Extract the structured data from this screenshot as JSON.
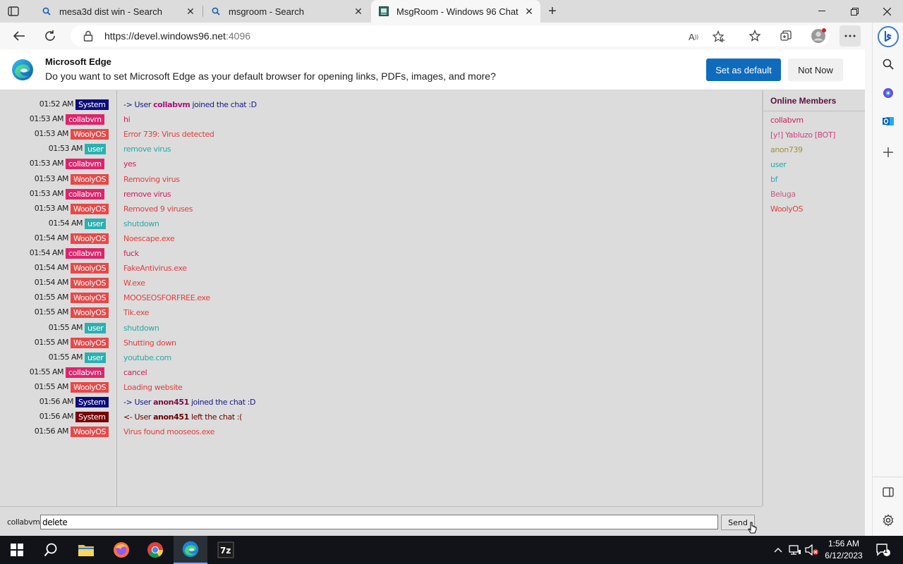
{
  "browser": {
    "tabs": [
      {
        "title": "mesa3d dist win - Search",
        "active": false
      },
      {
        "title": "msgroom - Search",
        "active": false
      },
      {
        "title": "MsgRoom - Windows 96 Chat",
        "active": true
      }
    ],
    "url_main": "https://devel.windows96.net",
    "url_port": ":4096"
  },
  "infobar": {
    "title": "Microsoft Edge",
    "text": "Do you want to set Microsoft Edge as your default browser for opening links, PDFs, images, and more?",
    "primary_label": "Set as default",
    "secondary_label": "Not Now"
  },
  "chat": {
    "messages": [
      {
        "time": "01:52 AM",
        "user": "System",
        "badge_color": "#0b0b7a",
        "pre": "-> User ",
        "bold": "collabvm",
        "post": " joined the chat :D",
        "text_color": "#1a1a8a",
        "bold_color": "#b0107a"
      },
      {
        "time": "01:53 AM",
        "user": "collabvm",
        "badge_color": "#e0236b",
        "text": "hi",
        "text_color": "#d0205a"
      },
      {
        "time": "01:53 AM",
        "user": "WoolyOS",
        "badge_color": "#e84848",
        "text": "Error 739: Virus detected",
        "text_color": "#e04040"
      },
      {
        "time": "01:53 AM",
        "user": "user",
        "badge_color": "#2bb0b0",
        "text": "remove virus",
        "text_color": "#2aa8a8"
      },
      {
        "time": "01:53 AM",
        "user": "collabvm",
        "badge_color": "#e0236b",
        "text": "yes",
        "text_color": "#d0205a"
      },
      {
        "time": "01:53 AM",
        "user": "WoolyOS",
        "badge_color": "#e84848",
        "text": "Removing virus",
        "text_color": "#e04040"
      },
      {
        "time": "01:53 AM",
        "user": "collabvm",
        "badge_color": "#e0236b",
        "text": "remove virus",
        "text_color": "#d0205a"
      },
      {
        "time": "01:53 AM",
        "user": "WoolyOS",
        "badge_color": "#e84848",
        "text": "Removed 9 viruses",
        "text_color": "#e04040"
      },
      {
        "time": "01:54 AM",
        "user": "user",
        "badge_color": "#2bb0b0",
        "text": "shutdown",
        "text_color": "#2aa8a8"
      },
      {
        "time": "01:54 AM",
        "user": "WoolyOS",
        "badge_color": "#e84848",
        "text": "Noescape.exe",
        "text_color": "#e04040"
      },
      {
        "time": "01:54 AM",
        "user": "collabvm",
        "badge_color": "#e0236b",
        "text": "fuck",
        "text_color": "#d0205a"
      },
      {
        "time": "01:54 AM",
        "user": "WoolyOS",
        "badge_color": "#e84848",
        "text": "FakeAntivirus.exe",
        "text_color": "#e04040"
      },
      {
        "time": "01:54 AM",
        "user": "WoolyOS",
        "badge_color": "#e84848",
        "text": "W.exe",
        "text_color": "#e04040"
      },
      {
        "time": "01:55 AM",
        "user": "WoolyOS",
        "badge_color": "#e84848",
        "text": "MOOSEOSFORFREE.exe",
        "text_color": "#e04040"
      },
      {
        "time": "01:55 AM",
        "user": "WoolyOS",
        "badge_color": "#e84848",
        "text": "Tik.exe",
        "text_color": "#e04040"
      },
      {
        "time": "01:55 AM",
        "user": "user",
        "badge_color": "#2bb0b0",
        "text": "shutdown",
        "text_color": "#2aa8a8"
      },
      {
        "time": "01:55 AM",
        "user": "WoolyOS",
        "badge_color": "#e84848",
        "text": "Shutting down",
        "text_color": "#e04040"
      },
      {
        "time": "01:55 AM",
        "user": "user",
        "badge_color": "#2bb0b0",
        "text": "youtube.com",
        "text_color": "#2aa8a8"
      },
      {
        "time": "01:55 AM",
        "user": "collabvm",
        "badge_color": "#e0236b",
        "text": "cancel",
        "text_color": "#d0205a"
      },
      {
        "time": "01:55 AM",
        "user": "WoolyOS",
        "badge_color": "#e84848",
        "text": "Loading website",
        "text_color": "#e04040"
      },
      {
        "time": "01:56 AM",
        "user": "System",
        "badge_color": "#0b0b7a",
        "pre": "-> User ",
        "bold": "anon451",
        "post": " joined the chat :D",
        "text_color": "#1a1a8a",
        "bold_color": "#7a1040"
      },
      {
        "time": "01:56 AM",
        "user": "System",
        "badge_color": "#7a0000",
        "pre": "<- User ",
        "bold": "anon451",
        "post": " left the chat :(",
        "text_color": "#6a0000",
        "bold_color": "#6a0000"
      },
      {
        "time": "01:56 AM",
        "user": "WoolyOS",
        "badge_color": "#e84848",
        "text": "Virus found mooseos.exe",
        "text_color": "#e04040"
      }
    ],
    "members_title": "Online Members",
    "members": [
      {
        "name": "collabvm",
        "color": "#d0205a"
      },
      {
        "name": "[y!] Yabluzo [BOT]",
        "color": "#d04080"
      },
      {
        "name": "anon739",
        "color": "#a09040"
      },
      {
        "name": "user",
        "color": "#2aa8a8"
      },
      {
        "name": "bf",
        "color": "#40a0c0"
      },
      {
        "name": "Beluga",
        "color": "#c06080"
      },
      {
        "name": "WoolyOS",
        "color": "#e04040"
      }
    ],
    "nick": "collabvm",
    "input_value": "delete",
    "send_label": "Send"
  },
  "taskbar": {
    "time": "1:56 AM",
    "date": "6/12/2023",
    "notification_count": "1",
    "apps": [
      "start",
      "search",
      "file-explorer",
      "firefox",
      "chrome",
      "edge",
      "7zip"
    ],
    "active_app": "edge"
  }
}
